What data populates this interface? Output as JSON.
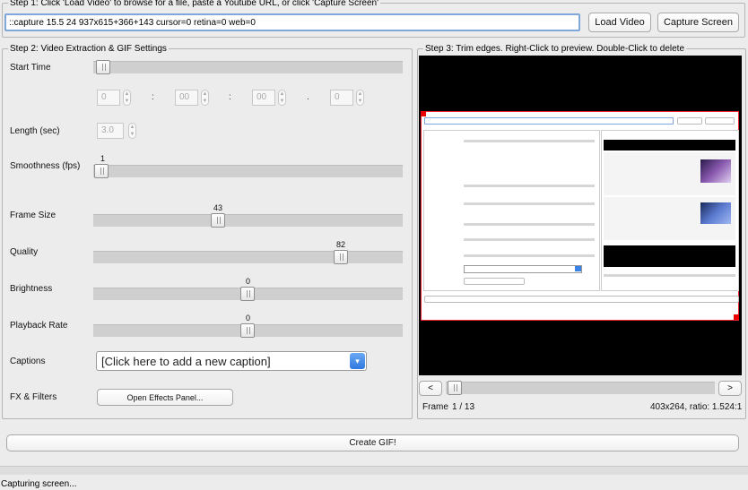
{
  "step1": {
    "legend": "Step 1: Click 'Load Video' to browse for a file, paste a Youtube URL, or click 'Capture Screen'",
    "url_value": "::capture 15.5 24 937x615+366+143 cursor=0 retina=0 web=0",
    "load_label": "Load Video",
    "capture_label": "Capture Screen"
  },
  "step2": {
    "legend": "Step 2: Video Extraction & GIF Settings",
    "start_time_label": "Start Time",
    "time_fields": [
      "0",
      "00",
      "00",
      "0"
    ],
    "time_sep_colon": ":",
    "time_sep_dot": ".",
    "length_label": "Length (sec)",
    "length_value": "3.0",
    "smoothness_label": "Smoothness (fps)",
    "smoothness_value": "1",
    "frame_size_label": "Frame Size",
    "frame_size_value": "43",
    "quality_label": "Quality",
    "quality_value": "82",
    "brightness_label": "Brightness",
    "brightness_value": "0",
    "playback_label": "Playback Rate",
    "playback_value": "0",
    "captions_label": "Captions",
    "captions_value": "[Click here to add a new caption]",
    "fx_label": "FX & Filters",
    "fx_button": "Open Effects Panel..."
  },
  "step3": {
    "legend": "Step 3: Trim edges. Right-Click to preview. Double-Click to delete",
    "prev_label": "<",
    "next_label": ">",
    "frame_label": "Frame",
    "frame_counter": "1 / 13",
    "dimensions": "403x264, ratio: 1.524:1"
  },
  "create_label": "Create GIF!",
  "status_text": "Capturing screen..."
}
